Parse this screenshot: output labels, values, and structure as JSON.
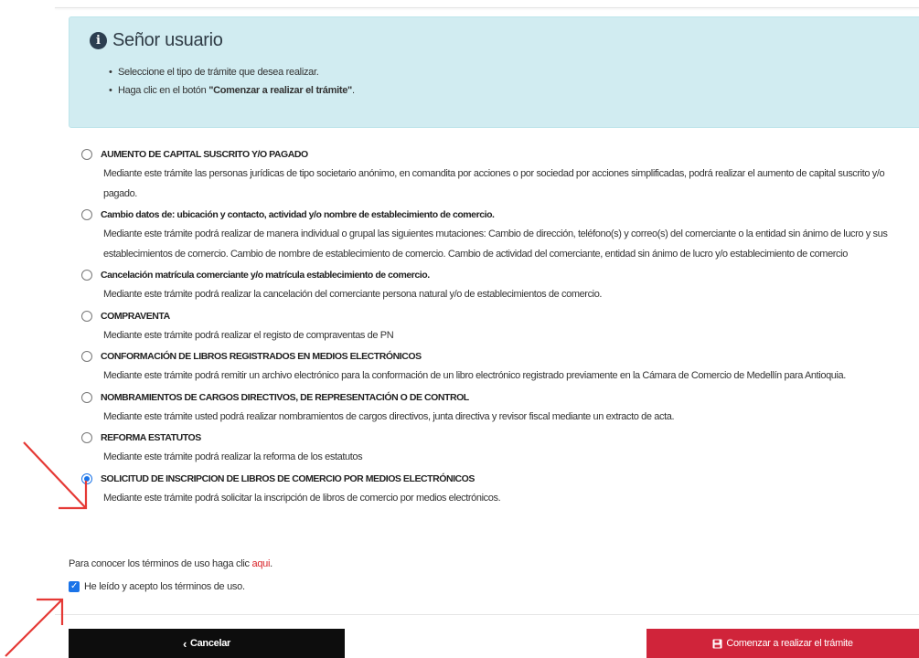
{
  "info_box": {
    "title": "Señor usuario",
    "items": [
      {
        "text": "Seleccione el tipo de trámite que desea realizar.",
        "bold": "",
        "suffix": ""
      },
      {
        "text": "Haga clic en el botón ",
        "bold": "\"Comenzar a realizar el trámite\"",
        "suffix": "."
      }
    ]
  },
  "options": [
    {
      "title": "AUMENTO DE CAPITAL SUSCRITO Y/O PAGADO",
      "description": "Mediante este trámite las personas jurídicas de tipo societario anónimo, en comandita por acciones o por sociedad por acciones simplificadas, podrá realizar el aumento de capital suscrito y/o pagado.",
      "selected": false
    },
    {
      "title": "Cambio datos de: ubicación y contacto, actividad y/o nombre de establecimiento de comercio.",
      "description": "Mediante este trámite podrá realizar de manera individual o grupal las siguientes mutaciones: Cambio de dirección, teléfono(s) y correo(s) del comerciante o la entidad sin ánimo de lucro y sus establecimientos de comercio. Cambio de nombre de establecimiento de comercio. Cambio de actividad del comerciante, entidad sin ánimo de lucro y/o establecimiento de comercio",
      "selected": false
    },
    {
      "title": "Cancelación matrícula comerciante y/o matrícula establecimiento de comercio.",
      "description": "Mediante este trámite podrá realizar la cancelación del comerciante persona natural y/o de establecimientos de comercio.",
      "selected": false
    },
    {
      "title": "COMPRAVENTA",
      "description": "Mediante este trámite podrá realizar el registo de compraventas de PN",
      "selected": false
    },
    {
      "title": "CONFORMACIÓN DE LIBROS REGISTRADOS EN MEDIOS ELECTRÓNICOS",
      "description": "Mediante este trámite podrá remitir un archivo electrónico para la conformación de un libro electrónico registrado previamente en la Cámara de Comercio de Medellín para Antioquia.",
      "selected": false
    },
    {
      "title": "NOMBRAMIENTOS DE CARGOS DIRECTIVOS, DE REPRESENTACIÓN O DE CONTROL",
      "description": "Mediante este trámite usted podrá realizar nombramientos de cargos directivos, junta directiva y revisor fiscal mediante un extracto de acta.",
      "selected": false
    },
    {
      "title": "REFORMA ESTATUTOS",
      "description": "Mediante este trámite podrá realizar la reforma de los estatutos",
      "selected": false
    },
    {
      "title": "SOLICITUD DE INSCRIPCION DE LIBROS DE COMERCIO POR MEDIOS ELECTRÓNICOS",
      "description": "Mediante este trámite podrá solicitar la inscripción de libros de comercio por medios electrónicos.",
      "selected": true
    }
  ],
  "terms": {
    "text": "Para conocer los términos de uso haga clic ",
    "link": "aqui",
    "suffix": "."
  },
  "accept": {
    "label": "He leído y acepto los términos de uso.",
    "checked": true
  },
  "buttons": {
    "cancel": "Cancelar",
    "start": "Comenzar a realizar el trámite"
  },
  "colors": {
    "info_bg": "#d1ecf1",
    "accent_blue": "#1a73e8",
    "primary_red": "#d0243a",
    "link_red": "#d9242a",
    "arrow_red": "#e53935",
    "cancel_black": "#0d0d0d"
  }
}
